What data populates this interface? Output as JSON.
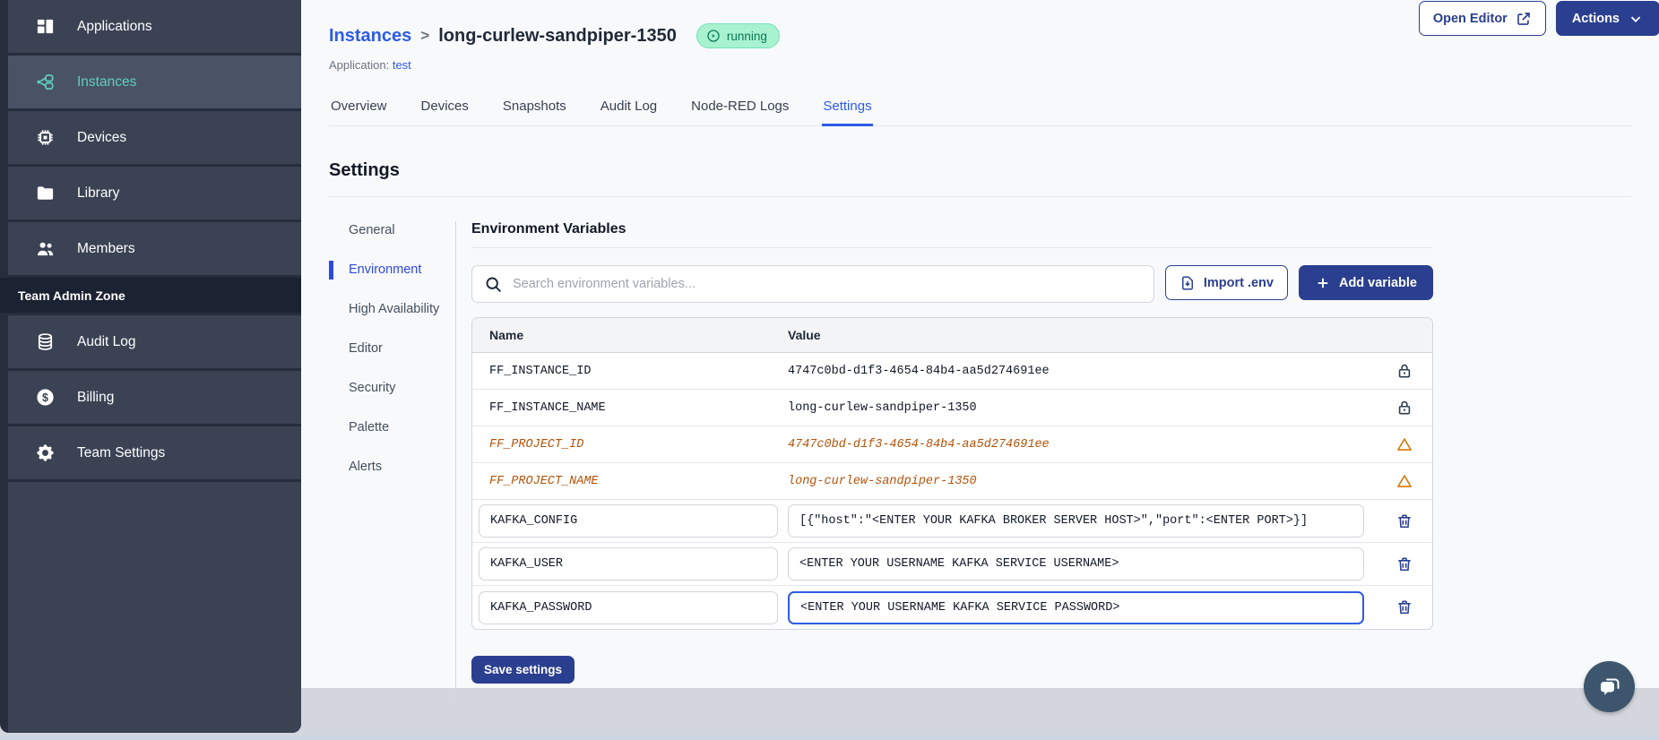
{
  "sidebar": {
    "items": [
      {
        "label": "Applications"
      },
      {
        "label": "Instances"
      },
      {
        "label": "Devices"
      },
      {
        "label": "Library"
      },
      {
        "label": "Members"
      }
    ],
    "section_label": "Team Admin Zone",
    "admin_items": [
      {
        "label": "Audit Log"
      },
      {
        "label": "Billing"
      },
      {
        "label": "Team Settings"
      }
    ]
  },
  "header": {
    "breadcrumb_root": "Instances",
    "breadcrumb_separator": ">",
    "instance_name": "long-curlew-sandpiper-1350",
    "status_badge": "running",
    "application_label": "Application:",
    "application_name": "test",
    "open_editor_label": "Open Editor",
    "actions_label": "Actions"
  },
  "tabs": [
    {
      "label": "Overview"
    },
    {
      "label": "Devices"
    },
    {
      "label": "Snapshots"
    },
    {
      "label": "Audit Log"
    },
    {
      "label": "Node-RED Logs"
    },
    {
      "label": "Settings"
    }
  ],
  "settings": {
    "title": "Settings",
    "nav": [
      "General",
      "Environment",
      "High Availability",
      "Editor",
      "Security",
      "Palette",
      "Alerts"
    ]
  },
  "env": {
    "title": "Environment Variables",
    "search_placeholder": "Search environment variables...",
    "import_label": "Import .env",
    "add_label": "Add variable",
    "save_label": "Save settings",
    "table": {
      "columns": [
        "Name",
        "Value"
      ],
      "rows": [
        {
          "name": "FF_INSTANCE_ID",
          "value": "4747c0bd-d1f3-4654-84b4-aa5d274691ee",
          "type": "locked"
        },
        {
          "name": "FF_INSTANCE_NAME",
          "value": "long-curlew-sandpiper-1350",
          "type": "locked"
        },
        {
          "name": "FF_PROJECT_ID",
          "value": "4747c0bd-d1f3-4654-84b4-aa5d274691ee",
          "type": "deprecated"
        },
        {
          "name": "FF_PROJECT_NAME",
          "value": "long-curlew-sandpiper-1350",
          "type": "deprecated"
        },
        {
          "name": "KAFKA_CONFIG",
          "value": "[{\"host\":\"<ENTER YOUR KAFKA BROKER SERVER HOST>\",\"port\":<ENTER PORT>}]",
          "type": "editable"
        },
        {
          "name": "KAFKA_USER",
          "value": "<ENTER YOUR USERNAME KAFKA SERVICE USERNAME>",
          "type": "editable"
        },
        {
          "name": "KAFKA_PASSWORD",
          "value": "<ENTER YOUR USERNAME KAFKA SERVICE PASSWORD>",
          "type": "editable",
          "focused": true
        }
      ]
    }
  },
  "colors": {
    "primary_button": "#2b3f90",
    "link_blue": "#2d5ce5",
    "sidebar_bg": "#262d3c",
    "sidebar_item_bg": "#3a4253",
    "sidebar_active_text": "#5fcfbe",
    "running_badge_bg": "#a9f2cf",
    "running_badge_text": "#0b7a57",
    "deprecated_orange": "#b45309",
    "warning_icon": "#d97706"
  }
}
